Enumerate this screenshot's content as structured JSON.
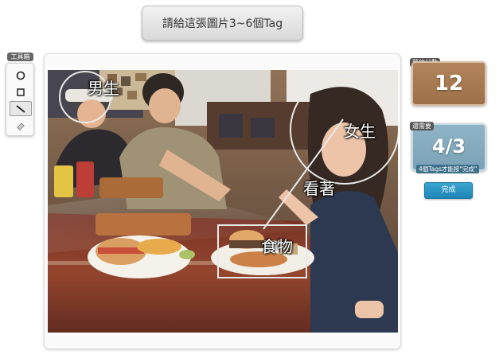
{
  "header": {
    "instruction": "請給這張圖片3~6個Tag"
  },
  "toolbox": {
    "label": "工具箱",
    "tools": [
      {
        "name": "circle-tool",
        "icon": "circle-icon"
      },
      {
        "name": "rectangle-tool",
        "icon": "square-icon"
      },
      {
        "name": "line-tool",
        "icon": "line-icon",
        "active": true
      },
      {
        "name": "eraser-tool",
        "icon": "eraser-icon"
      }
    ]
  },
  "image": {
    "tags": [
      {
        "label": "男生",
        "shape": "circle"
      },
      {
        "label": "女生",
        "shape": "circle"
      },
      {
        "label": "看著",
        "shape": "line"
      },
      {
        "label": "食物",
        "shape": "rectangle"
      }
    ]
  },
  "score": {
    "label": "預估分數",
    "value": "12"
  },
  "progress": {
    "label": "還需要",
    "value": "4/3",
    "hint": "4個Tags才能按\"完成\""
  },
  "actions": {
    "done_label": "完成"
  },
  "colors": {
    "score_box": "#a77b52",
    "progress_box": "#85aabf",
    "done_button": "#2a95c4"
  }
}
